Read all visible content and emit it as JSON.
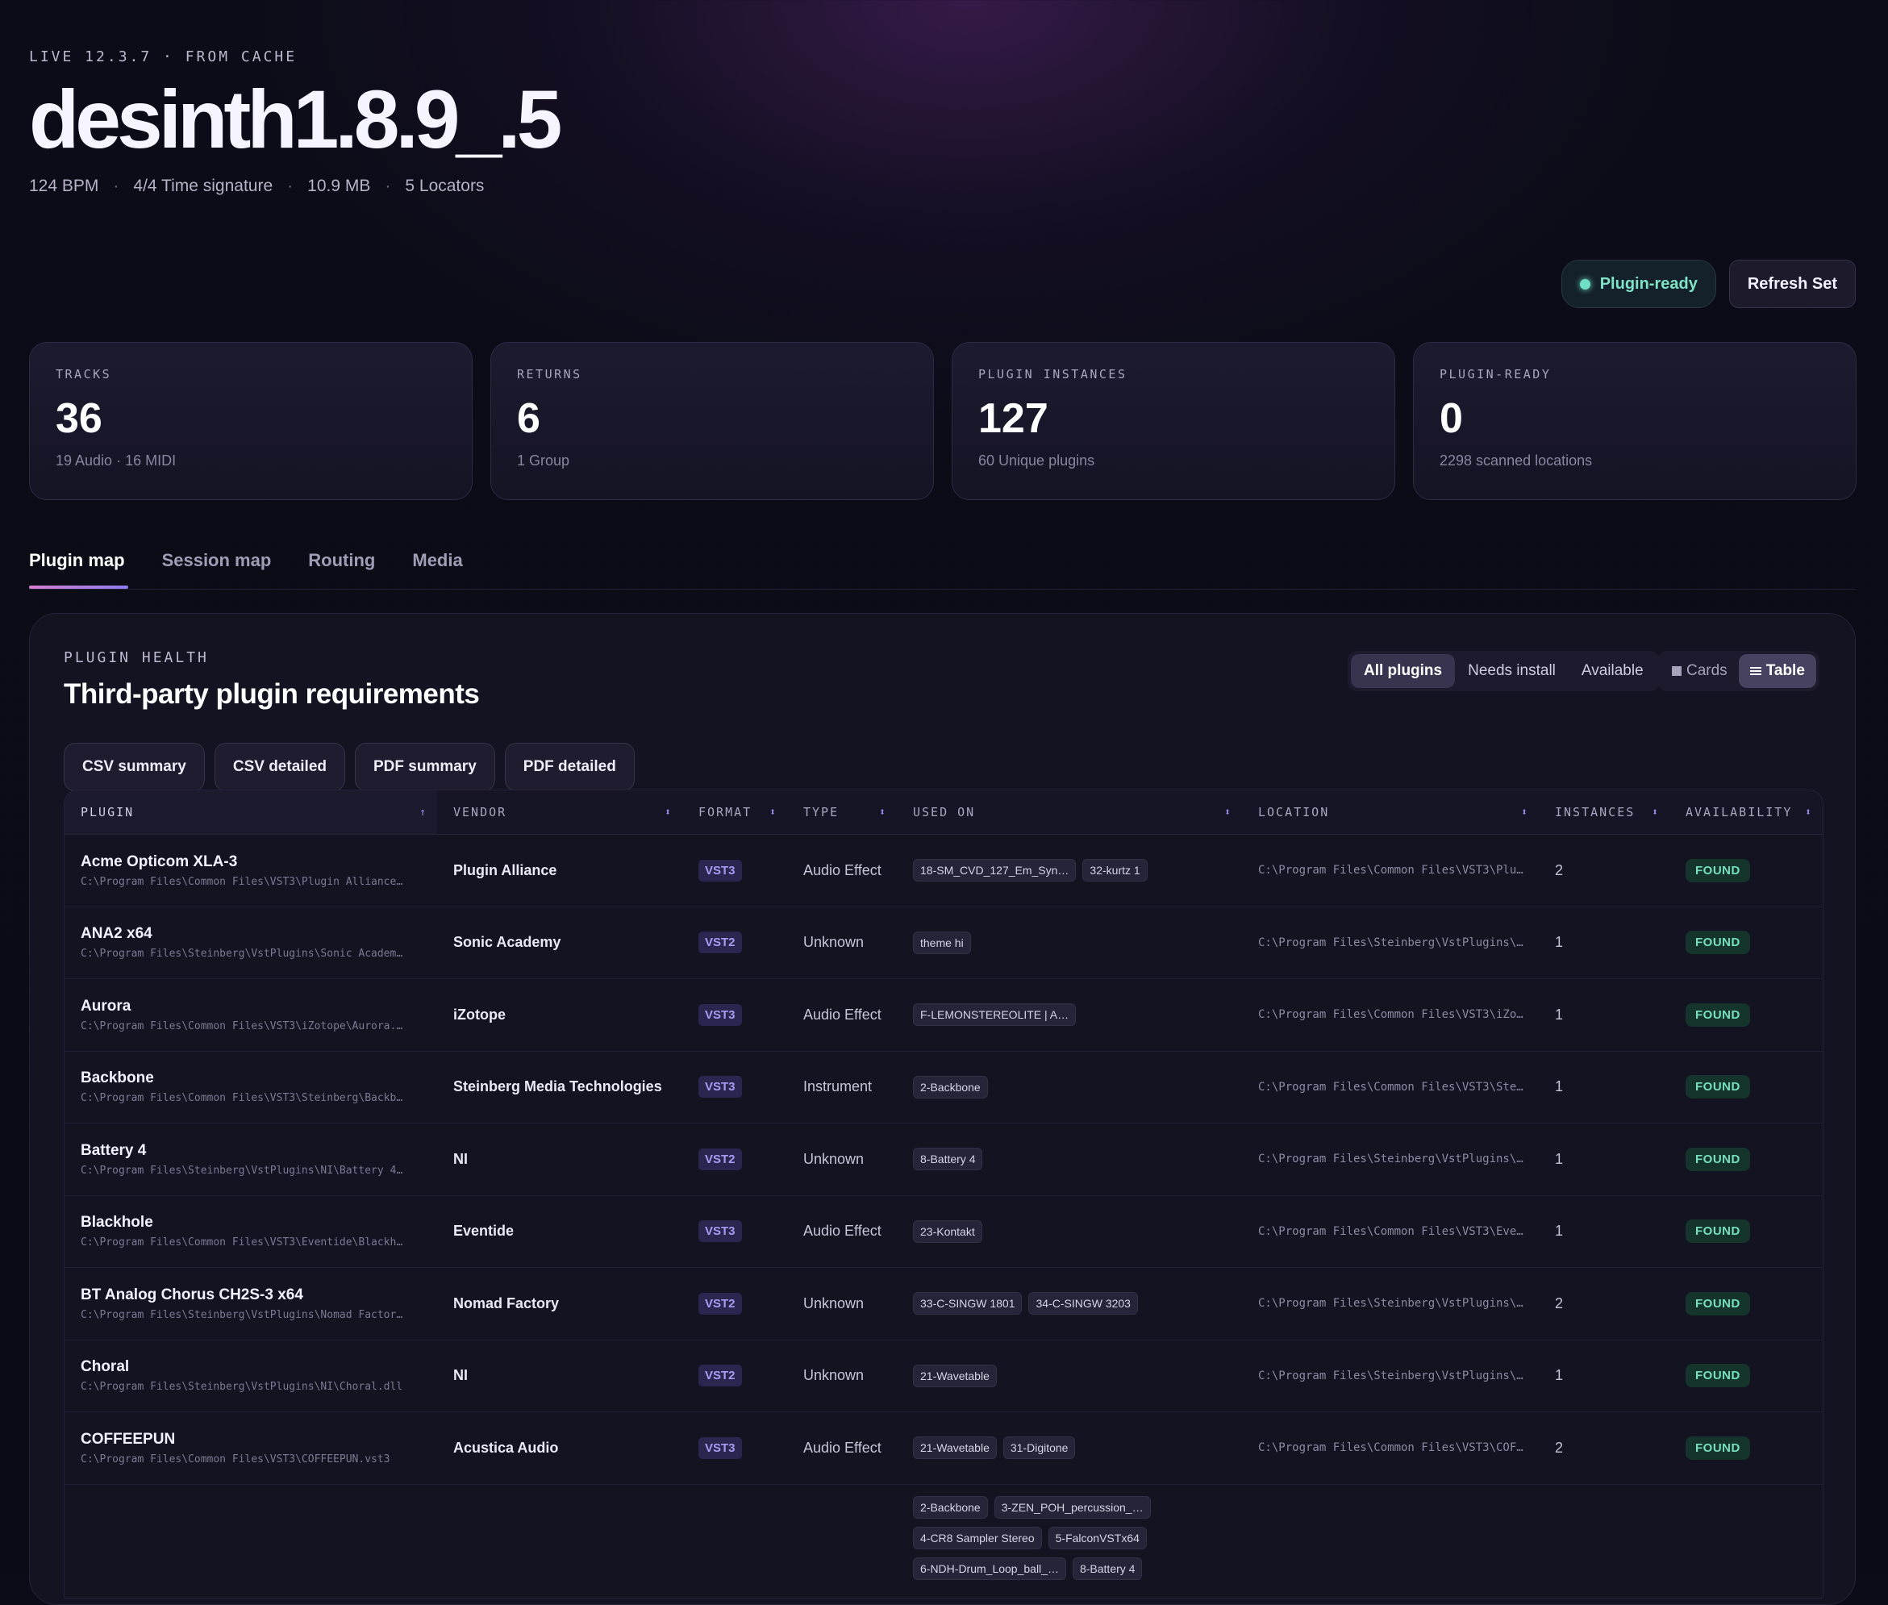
{
  "header": {
    "eyebrow": "LIVE 12.3.7 · FROM CACHE",
    "title": "desinth1.8.9_.5",
    "meta": [
      "124 BPM",
      "4/4 Time signature",
      "10.9 MB",
      "5 Locators"
    ]
  },
  "actions": {
    "status": "Plugin-ready",
    "refresh": "Refresh Set"
  },
  "stats": [
    {
      "label": "TRACKS",
      "value": "36",
      "sub": "19 Audio · 16 MIDI"
    },
    {
      "label": "RETURNS",
      "value": "6",
      "sub": "1 Group"
    },
    {
      "label": "PLUGIN INSTANCES",
      "value": "127",
      "sub": "60 Unique plugins"
    },
    {
      "label": "PLUGIN-READY",
      "value": "0",
      "sub": "2298 scanned locations"
    }
  ],
  "tabs": [
    "Plugin map",
    "Session map",
    "Routing",
    "Media"
  ],
  "panel": {
    "eyebrow": "PLUGIN HEALTH",
    "title": "Third-party plugin requirements",
    "filters": [
      "All plugins",
      "Needs install",
      "Available"
    ],
    "views": [
      "Cards",
      "Table"
    ],
    "exports": [
      "CSV summary",
      "CSV detailed",
      "PDF summary",
      "PDF detailed"
    ]
  },
  "table": {
    "columns": [
      "PLUGIN",
      "VENDOR",
      "FORMAT",
      "TYPE",
      "USED ON",
      "LOCATION",
      "INSTANCES",
      "AVAILABILITY"
    ],
    "rows": [
      {
        "name": "Acme Opticom XLA-3",
        "path": "C:\\Program Files\\Common Files\\VST3\\Plugin Alliance…",
        "vendor": "Plugin Alliance",
        "format": "VST3",
        "type": "Audio Effect",
        "used": [
          "18-SM_CVD_127_Em_Syn…",
          "32-kurtz 1"
        ],
        "location": "C:\\Program Files\\Common Files\\VST3\\Plu…",
        "instances": "2",
        "availability": "FOUND"
      },
      {
        "name": "ANA2 x64",
        "path": "C:\\Program Files\\Steinberg\\VstPlugins\\Sonic Academ…",
        "vendor": "Sonic Academy",
        "format": "VST2",
        "type": "Unknown",
        "used": [
          "theme hi"
        ],
        "location": "C:\\Program Files\\Steinberg\\VstPlugins\\…",
        "instances": "1",
        "availability": "FOUND"
      },
      {
        "name": "Aurora",
        "path": "C:\\Program Files\\Common Files\\VST3\\iZotope\\Aurora.…",
        "vendor": "iZotope",
        "format": "VST3",
        "type": "Audio Effect",
        "used": [
          "F-LEMONSTEREOLITE | A…"
        ],
        "location": "C:\\Program Files\\Common Files\\VST3\\iZo…",
        "instances": "1",
        "availability": "FOUND"
      },
      {
        "name": "Backbone",
        "path": "C:\\Program Files\\Common Files\\VST3\\Steinberg\\Backb…",
        "vendor": "Steinberg Media Technologies",
        "format": "VST3",
        "type": "Instrument",
        "used": [
          "2-Backbone"
        ],
        "location": "C:\\Program Files\\Common Files\\VST3\\Ste…",
        "instances": "1",
        "availability": "FOUND"
      },
      {
        "name": "Battery 4",
        "path": "C:\\Program Files\\Steinberg\\VstPlugins\\NI\\Battery 4…",
        "vendor": "NI",
        "format": "VST2",
        "type": "Unknown",
        "used": [
          "8-Battery 4"
        ],
        "location": "C:\\Program Files\\Steinberg\\VstPlugins\\…",
        "instances": "1",
        "availability": "FOUND"
      },
      {
        "name": "Blackhole",
        "path": "C:\\Program Files\\Common Files\\VST3\\Eventide\\Blackh…",
        "vendor": "Eventide",
        "format": "VST3",
        "type": "Audio Effect",
        "used": [
          "23-Kontakt"
        ],
        "location": "C:\\Program Files\\Common Files\\VST3\\Eve…",
        "instances": "1",
        "availability": "FOUND"
      },
      {
        "name": "BT Analog Chorus CH2S-3 x64",
        "path": "C:\\Program Files\\Steinberg\\VstPlugins\\Nomad Factor…",
        "vendor": "Nomad Factory",
        "format": "VST2",
        "type": "Unknown",
        "used": [
          "33-C-SINGW 1801",
          "34-C-SINGW 3203"
        ],
        "location": "C:\\Program Files\\Steinberg\\VstPlugins\\…",
        "instances": "2",
        "availability": "FOUND"
      },
      {
        "name": "Choral",
        "path": "C:\\Program Files\\Steinberg\\VstPlugins\\NI\\Choral.dll",
        "vendor": "NI",
        "format": "VST2",
        "type": "Unknown",
        "used": [
          "21-Wavetable"
        ],
        "location": "C:\\Program Files\\Steinberg\\VstPlugins\\…",
        "instances": "1",
        "availability": "FOUND"
      },
      {
        "name": "COFFEEPUN",
        "path": "C:\\Program Files\\Common Files\\VST3\\COFFEEPUN.vst3",
        "vendor": "Acustica Audio",
        "format": "VST3",
        "type": "Audio Effect",
        "used": [
          "21-Wavetable",
          "31-Digitone"
        ],
        "location": "C:\\Program Files\\Common Files\\VST3\\COF…",
        "instances": "2",
        "availability": "FOUND"
      }
    ],
    "partial_row_used": [
      "2-Backbone",
      "3-ZEN_POH_percussion_…",
      "4-CR8 Sampler Stereo",
      "5-FalconVSTx64",
      "6-NDH-Drum_Loop_ball_…",
      "8-Battery 4"
    ]
  }
}
